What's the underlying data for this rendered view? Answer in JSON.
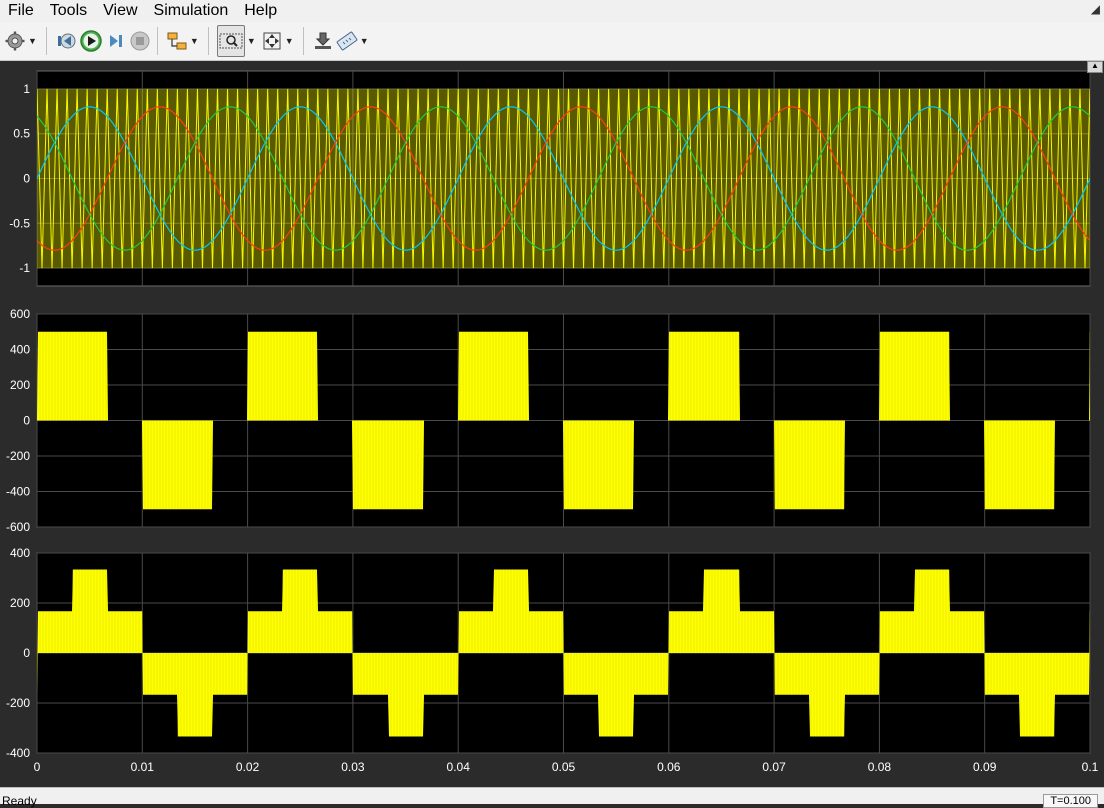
{
  "menu": [
    "File",
    "Tools",
    "View",
    "Simulation",
    "Help"
  ],
  "toolbar": {
    "items": [
      {
        "name": "settings-icon",
        "dropdown": true
      },
      {
        "name": "step-back-icon"
      },
      {
        "name": "run-icon"
      },
      {
        "name": "step-forward-icon"
      },
      {
        "name": "stop-icon"
      },
      {
        "name": "highlight-block-icon",
        "dropdown": true
      },
      {
        "name": "zoom-icon",
        "dropdown": true,
        "pressed": true
      },
      {
        "name": "fit-to-view-icon",
        "dropdown": true
      },
      {
        "name": "cursor-measurement-icon"
      },
      {
        "name": "triggers-icon",
        "dropdown": true
      }
    ]
  },
  "colors": {
    "plot_bg": "#000000",
    "outer_bg": "#2b2b2b",
    "grid": "#4a4a4a",
    "trace": "#ffff00",
    "axis_text": "#ffffff",
    "phase_a": "#00c8ff",
    "phase_b": "#ff3a1a",
    "phase_c": "#1ec850"
  },
  "chart_data": [
    {
      "type": "line",
      "title": "",
      "series": [
        {
          "name": "",
          "description": "sinusoidal references 50 Hz amplitude 0.8 at 0, -120, +120 deg",
          "values": [
            0.8,
            0.8,
            0.8
          ],
          "phases_deg": [
            0,
            -120,
            120
          ],
          "frequency_hz": 50
        },
        {
          "name": "",
          "description": "triangular carrier amplitude 1",
          "amplitude": 1
        }
      ],
      "xlim": [
        0,
        0.1
      ],
      "ylim": [
        -1.2,
        1.2
      ],
      "yticks": [
        "1",
        "0.5",
        "0",
        "-0.5",
        "-1"
      ],
      "grid": true
    },
    {
      "type": "line",
      "title": "",
      "description": "PWM line voltage, alternating +500 / -500 pulse blocks",
      "levels": [
        500,
        0,
        -500
      ],
      "frequency_hz": 50,
      "xlim": [
        0,
        0.1
      ],
      "ylim": [
        -600,
        600
      ],
      "yticks": [
        "600",
        "400",
        "200",
        "0",
        "-200",
        "-400",
        "-600"
      ],
      "grid": true
    },
    {
      "type": "line",
      "title": "",
      "description": "PWM phase voltage with levels +333, +167, 0, -167, -333",
      "levels": [
        333,
        167,
        0,
        -167,
        -333
      ],
      "frequency_hz": 50,
      "xlim": [
        0,
        0.1
      ],
      "ylim": [
        -400,
        400
      ],
      "yticks": [
        "400",
        "200",
        "0",
        "-200",
        "-400"
      ],
      "xticks": [
        "0",
        "0.01",
        "0.02",
        "0.03",
        "0.04",
        "0.05",
        "0.06",
        "0.07",
        "0.08",
        "0.09",
        "0.1"
      ],
      "grid": true
    }
  ],
  "status": {
    "text": "Ready",
    "time": "T=0.100"
  }
}
